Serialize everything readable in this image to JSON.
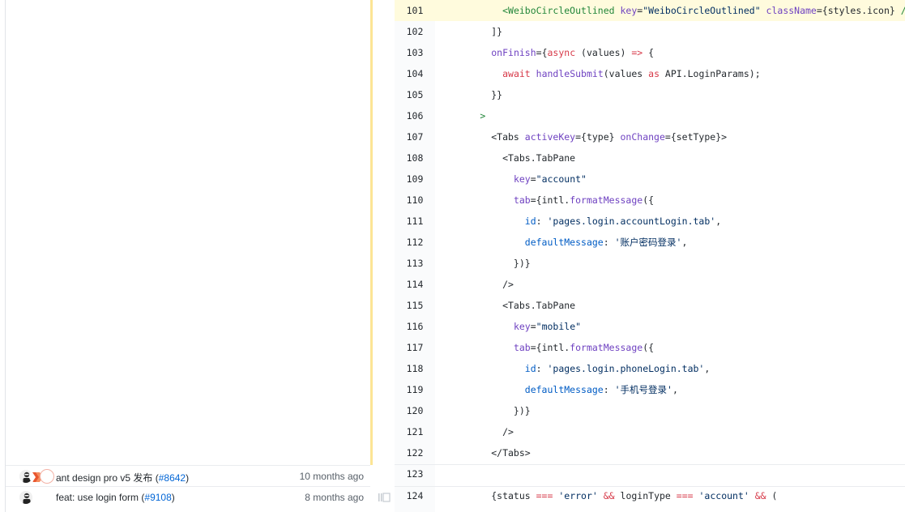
{
  "blame": [
    {
      "message": "ant design pro v5 发布 ",
      "pr": "#8642",
      "time": "10 months ago"
    },
    {
      "message": "feat: use login form ",
      "pr": "#9108",
      "time": "8 months ago"
    }
  ],
  "code": {
    "lines": [
      {
        "n": "101",
        "tokens": [
          {
            "t": "            ",
            "c": "plain"
          },
          {
            "t": "<WeiboCircleOutlined",
            "c": "tag"
          },
          {
            "t": " key",
            "c": "attr"
          },
          {
            "t": "=",
            "c": "plain"
          },
          {
            "t": "\"WeiboCircleOutlined\"",
            "c": "str"
          },
          {
            "t": " className",
            "c": "attr"
          },
          {
            "t": "={styles.icon}",
            "c": "plain"
          },
          {
            "t": " />,",
            "c": "tag"
          }
        ]
      },
      {
        "n": "102",
        "tokens": [
          {
            "t": "          ]}",
            "c": "plain"
          }
        ]
      },
      {
        "n": "103",
        "tokens": [
          {
            "t": "          ",
            "c": "plain"
          },
          {
            "t": "onFinish",
            "c": "attr"
          },
          {
            "t": "={",
            "c": "plain"
          },
          {
            "t": "async",
            "c": "kw"
          },
          {
            "t": " (values) ",
            "c": "plain"
          },
          {
            "t": "=>",
            "c": "kw"
          },
          {
            "t": " {",
            "c": "plain"
          }
        ]
      },
      {
        "n": "104",
        "tokens": [
          {
            "t": "            ",
            "c": "plain"
          },
          {
            "t": "await",
            "c": "kw"
          },
          {
            "t": " ",
            "c": "plain"
          },
          {
            "t": "handleSubmit",
            "c": "fn"
          },
          {
            "t": "(values ",
            "c": "plain"
          },
          {
            "t": "as",
            "c": "kw"
          },
          {
            "t": " API.LoginParams);",
            "c": "plain"
          }
        ]
      },
      {
        "n": "105",
        "tokens": [
          {
            "t": "          }}",
            "c": "plain"
          }
        ]
      },
      {
        "n": "106",
        "tokens": [
          {
            "t": "        >",
            "c": "tag"
          }
        ]
      },
      {
        "n": "107",
        "tokens": [
          {
            "t": "          <Tabs",
            "c": "plain"
          },
          {
            "t": " activeKey",
            "c": "attr"
          },
          {
            "t": "={type} ",
            "c": "plain"
          },
          {
            "t": "onChange",
            "c": "attr"
          },
          {
            "t": "={setType}>",
            "c": "plain"
          }
        ]
      },
      {
        "n": "108",
        "tokens": [
          {
            "t": "            <Tabs.TabPane",
            "c": "plain"
          }
        ]
      },
      {
        "n": "109",
        "tokens": [
          {
            "t": "              ",
            "c": "plain"
          },
          {
            "t": "key",
            "c": "attr"
          },
          {
            "t": "=",
            "c": "plain"
          },
          {
            "t": "\"account\"",
            "c": "str"
          }
        ]
      },
      {
        "n": "110",
        "tokens": [
          {
            "t": "              ",
            "c": "plain"
          },
          {
            "t": "tab",
            "c": "attr"
          },
          {
            "t": "={intl.",
            "c": "plain"
          },
          {
            "t": "formatMessage",
            "c": "fn"
          },
          {
            "t": "({",
            "c": "plain"
          }
        ]
      },
      {
        "n": "111",
        "tokens": [
          {
            "t": "                ",
            "c": "plain"
          },
          {
            "t": "id",
            "c": "prop"
          },
          {
            "t": ": ",
            "c": "plain"
          },
          {
            "t": "'pages.login.accountLogin.tab'",
            "c": "str"
          },
          {
            "t": ",",
            "c": "plain"
          }
        ]
      },
      {
        "n": "112",
        "tokens": [
          {
            "t": "                ",
            "c": "plain"
          },
          {
            "t": "defaultMessage",
            "c": "prop"
          },
          {
            "t": ": ",
            "c": "plain"
          },
          {
            "t": "'账户密码登录'",
            "c": "str"
          },
          {
            "t": ",",
            "c": "plain"
          }
        ]
      },
      {
        "n": "113",
        "tokens": [
          {
            "t": "              })}",
            "c": "plain"
          }
        ]
      },
      {
        "n": "114",
        "tokens": [
          {
            "t": "            />",
            "c": "plain"
          }
        ]
      },
      {
        "n": "115",
        "tokens": [
          {
            "t": "            <Tabs.TabPane",
            "c": "plain"
          }
        ]
      },
      {
        "n": "116",
        "tokens": [
          {
            "t": "              ",
            "c": "plain"
          },
          {
            "t": "key",
            "c": "attr"
          },
          {
            "t": "=",
            "c": "plain"
          },
          {
            "t": "\"mobile\"",
            "c": "str"
          }
        ]
      },
      {
        "n": "117",
        "tokens": [
          {
            "t": "              ",
            "c": "plain"
          },
          {
            "t": "tab",
            "c": "attr"
          },
          {
            "t": "={intl.",
            "c": "plain"
          },
          {
            "t": "formatMessage",
            "c": "fn"
          },
          {
            "t": "({",
            "c": "plain"
          }
        ]
      },
      {
        "n": "118",
        "tokens": [
          {
            "t": "                ",
            "c": "plain"
          },
          {
            "t": "id",
            "c": "prop"
          },
          {
            "t": ": ",
            "c": "plain"
          },
          {
            "t": "'pages.login.phoneLogin.tab'",
            "c": "str"
          },
          {
            "t": ",",
            "c": "plain"
          }
        ]
      },
      {
        "n": "119",
        "tokens": [
          {
            "t": "                ",
            "c": "plain"
          },
          {
            "t": "defaultMessage",
            "c": "prop"
          },
          {
            "t": ": ",
            "c": "plain"
          },
          {
            "t": "'手机号登录'",
            "c": "str"
          },
          {
            "t": ",",
            "c": "plain"
          }
        ]
      },
      {
        "n": "120",
        "tokens": [
          {
            "t": "              })}",
            "c": "plain"
          }
        ]
      },
      {
        "n": "121",
        "tokens": [
          {
            "t": "            />",
            "c": "plain"
          }
        ]
      },
      {
        "n": "122",
        "tokens": [
          {
            "t": "          </Tabs>",
            "c": "plain"
          }
        ]
      },
      {
        "n": "123",
        "tokens": [
          {
            "t": "",
            "c": "plain"
          }
        ]
      },
      {
        "n": "124",
        "tokens": [
          {
            "t": "          {status ",
            "c": "plain"
          },
          {
            "t": "===",
            "c": "kw"
          },
          {
            "t": " ",
            "c": "plain"
          },
          {
            "t": "'error'",
            "c": "str"
          },
          {
            "t": " ",
            "c": "plain"
          },
          {
            "t": "&&",
            "c": "kw"
          },
          {
            "t": " loginType ",
            "c": "plain"
          },
          {
            "t": "===",
            "c": "kw"
          },
          {
            "t": " ",
            "c": "plain"
          },
          {
            "t": "'account'",
            "c": "str"
          },
          {
            "t": " ",
            "c": "plain"
          },
          {
            "t": "&&",
            "c": "kw"
          },
          {
            "t": " (",
            "c": "plain"
          }
        ]
      }
    ]
  },
  "colors": {
    "highlight": "#fffbdd",
    "age_bar": "#f9c513",
    "link": "#0366d6",
    "muted": "#586069"
  },
  "icons": [
    "avatar-pair",
    "reblame-icon"
  ]
}
